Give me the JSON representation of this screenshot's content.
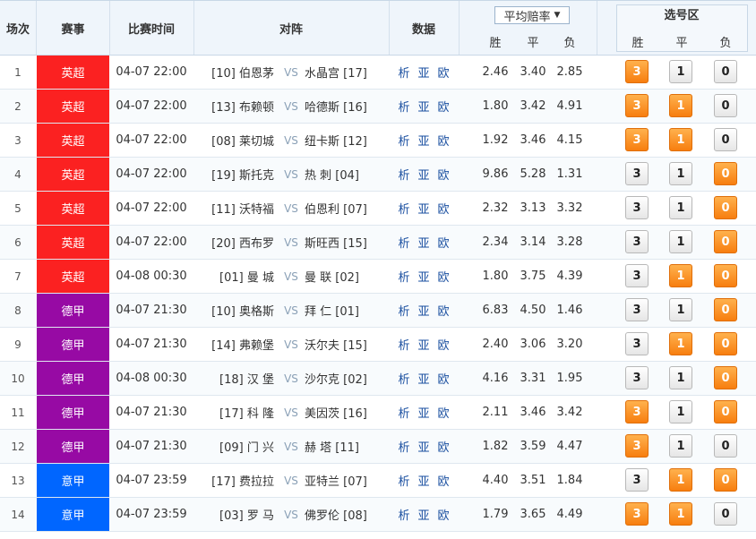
{
  "header": {
    "no": "场次",
    "league": "赛事",
    "time": "比赛时间",
    "match": "对阵",
    "data": "数据",
    "avg_select": "平均赔率",
    "avg_arrow": "▼",
    "odds_sub": [
      "胜",
      "平",
      "负"
    ],
    "pick_title": "选号区",
    "pick_sub": [
      "胜",
      "平",
      "负"
    ]
  },
  "colors": {
    "英超": "#fb2121",
    "德甲": "#970aa4",
    "意甲": "#0066ff",
    "selected_button": "#f77e0f"
  },
  "data_links": [
    "析",
    "亚",
    "欧"
  ],
  "vs_label": "VS",
  "button_labels": [
    "3",
    "1",
    "0"
  ],
  "rows": [
    {
      "no": "1",
      "league": "英超",
      "time": "04-07 22:00",
      "home": "[10] 伯恩茅",
      "away": "水晶宫 [17]",
      "odds": [
        "2.46",
        "3.40",
        "2.85"
      ],
      "sel": [
        true,
        false,
        false
      ]
    },
    {
      "no": "2",
      "league": "英超",
      "time": "04-07 22:00",
      "home": "[13] 布赖顿",
      "away": "哈德斯 [16]",
      "odds": [
        "1.80",
        "3.42",
        "4.91"
      ],
      "sel": [
        true,
        true,
        false
      ]
    },
    {
      "no": "3",
      "league": "英超",
      "time": "04-07 22:00",
      "home": "[08] 莱切城",
      "away": "纽卡斯 [12]",
      "odds": [
        "1.92",
        "3.46",
        "4.15"
      ],
      "sel": [
        true,
        true,
        false
      ]
    },
    {
      "no": "4",
      "league": "英超",
      "time": "04-07 22:00",
      "home": "[19] 斯托克",
      "away": "热 刺 [04]",
      "odds": [
        "9.86",
        "5.28",
        "1.31"
      ],
      "sel": [
        false,
        false,
        true
      ]
    },
    {
      "no": "5",
      "league": "英超",
      "time": "04-07 22:00",
      "home": "[11] 沃特福",
      "away": "伯恩利 [07]",
      "odds": [
        "2.32",
        "3.13",
        "3.32"
      ],
      "sel": [
        false,
        false,
        true
      ]
    },
    {
      "no": "6",
      "league": "英超",
      "time": "04-07 22:00",
      "home": "[20] 西布罗",
      "away": "斯旺西 [15]",
      "odds": [
        "2.34",
        "3.14",
        "3.28"
      ],
      "sel": [
        false,
        false,
        true
      ]
    },
    {
      "no": "7",
      "league": "英超",
      "time": "04-08 00:30",
      "home": "[01] 曼 城",
      "away": "曼 联 [02]",
      "odds": [
        "1.80",
        "3.75",
        "4.39"
      ],
      "sel": [
        false,
        true,
        true
      ]
    },
    {
      "no": "8",
      "league": "德甲",
      "time": "04-07 21:30",
      "home": "[10] 奥格斯",
      "away": "拜 仁 [01]",
      "odds": [
        "6.83",
        "4.50",
        "1.46"
      ],
      "sel": [
        false,
        false,
        true
      ]
    },
    {
      "no": "9",
      "league": "德甲",
      "time": "04-07 21:30",
      "home": "[14] 弗赖堡",
      "away": "沃尔夫 [15]",
      "odds": [
        "2.40",
        "3.06",
        "3.20"
      ],
      "sel": [
        false,
        true,
        true
      ]
    },
    {
      "no": "10",
      "league": "德甲",
      "time": "04-08 00:30",
      "home": "[18] 汉 堡",
      "away": "沙尔克 [02]",
      "odds": [
        "4.16",
        "3.31",
        "1.95"
      ],
      "sel": [
        false,
        false,
        true
      ]
    },
    {
      "no": "11",
      "league": "德甲",
      "time": "04-07 21:30",
      "home": "[17] 科 隆",
      "away": "美因茨 [16]",
      "odds": [
        "2.11",
        "3.46",
        "3.42"
      ],
      "sel": [
        true,
        false,
        true
      ]
    },
    {
      "no": "12",
      "league": "德甲",
      "time": "04-07 21:30",
      "home": "[09] 门 兴",
      "away": "赫 塔 [11]",
      "odds": [
        "1.82",
        "3.59",
        "4.47"
      ],
      "sel": [
        true,
        false,
        false
      ]
    },
    {
      "no": "13",
      "league": "意甲",
      "time": "04-07 23:59",
      "home": "[17] 费拉拉",
      "away": "亚特兰 [07]",
      "odds": [
        "4.40",
        "3.51",
        "1.84"
      ],
      "sel": [
        false,
        true,
        true
      ]
    },
    {
      "no": "14",
      "league": "意甲",
      "time": "04-07 23:59",
      "home": "[03] 罗 马",
      "away": "佛罗伦 [08]",
      "odds": [
        "1.79",
        "3.65",
        "4.49"
      ],
      "sel": [
        true,
        true,
        false
      ]
    }
  ]
}
